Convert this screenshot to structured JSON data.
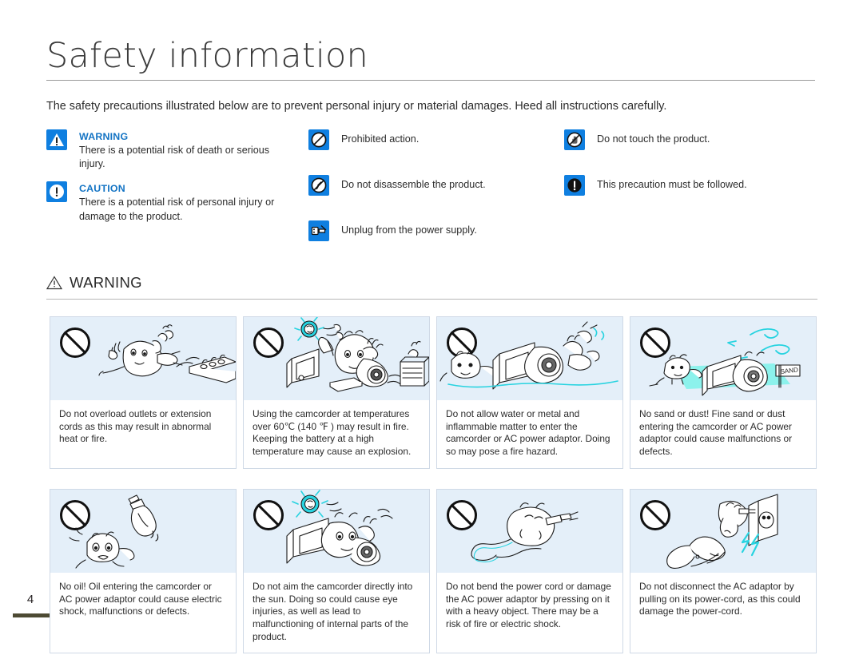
{
  "document": {
    "title": "Safety information",
    "intro": "The safety precautions illustrated below are to prevent personal injury or material damages. Heed all instructions carefully.",
    "page_number": "4"
  },
  "legend": {
    "column1": [
      {
        "icon": "warning-triangle-icon",
        "heading": "WARNING",
        "body": "There is a potential risk of death or serious injury."
      },
      {
        "icon": "caution-exclamation-circle-icon",
        "heading": "CAUTION",
        "body": "There is a potential risk of personal injury or damage to the product."
      }
    ],
    "column2": [
      {
        "icon": "prohibited-circle-slash-icon",
        "label": "Prohibited action."
      },
      {
        "icon": "do-not-disassemble-icon",
        "label": "Do not disassemble the product."
      },
      {
        "icon": "unplug-power-icon",
        "label": "Unplug from the power supply."
      }
    ],
    "column3": [
      {
        "icon": "do-not-touch-hand-icon",
        "label": "Do not touch the product."
      },
      {
        "icon": "must-be-followed-exclamation-icon",
        "label": "This precaution must be followed."
      }
    ]
  },
  "warning_section": {
    "icon": "warning-triangle-outline-icon",
    "heading": "WARNING",
    "cards": [
      {
        "illustration": "overloaded-outlet-illustration",
        "badge_icon": "prohibited-circle-slash-icon",
        "text": "Do not overload outlets or extension cords as this may result in abnormal heat or fire."
      },
      {
        "illustration": "camcorder-high-temperature-illustration",
        "badge_icon": "prohibited-circle-slash-icon",
        "text": "Using the camcorder at temperatures over 60℃ (140 ℉ ) may result in fire. Keeping the battery at a high temperature may cause an explosion."
      },
      {
        "illustration": "water-metal-entering-camcorder-illustration",
        "badge_icon": "prohibited-circle-slash-icon",
        "text": "Do not allow water or metal and inflammable matter to enter the camcorder or AC power adaptor. Doing so may pose a fire hazard."
      },
      {
        "illustration": "sand-and-dust-illustration",
        "badge_icon": "prohibited-circle-slash-icon",
        "text": "No sand or dust! Fine sand or dust entering the camcorder or AC power adaptor could cause malfunctions or defects."
      },
      {
        "illustration": "oil-entering-camcorder-illustration",
        "badge_icon": "prohibited-circle-slash-icon",
        "text": "No oil! Oil entering the camcorder or AC power adaptor could cause electric shock, malfunctions or defects."
      },
      {
        "illustration": "camcorder-aimed-at-sun-illustration",
        "badge_icon": "prohibited-circle-slash-icon",
        "text": "Do not aim the camcorder directly into the sun. Doing so could cause eye injuries, as well as lead to malfunctioning of internal parts of the product."
      },
      {
        "illustration": "bent-power-cord-illustration",
        "badge_icon": "prohibited-circle-slash-icon",
        "text": "Do not bend the power cord or damage the AC power adaptor by pressing on it with a heavy object. There may be a risk of fire or electric shock."
      },
      {
        "illustration": "pulling-ac-adaptor-by-cord-illustration",
        "badge_icon": "prohibited-circle-slash-icon",
        "text": "Do not disconnect the AC adaptor by pulling on its power-cord, as this could damage the power-cord."
      }
    ]
  },
  "colors": {
    "brand_blue": "#0f7fe0",
    "heading_blue": "#1474c4",
    "illustration_bg": "#e4eff9",
    "card_border": "#cfd9e6",
    "accent_cyan": "#28d3e0",
    "text": "#2b2b2b"
  }
}
